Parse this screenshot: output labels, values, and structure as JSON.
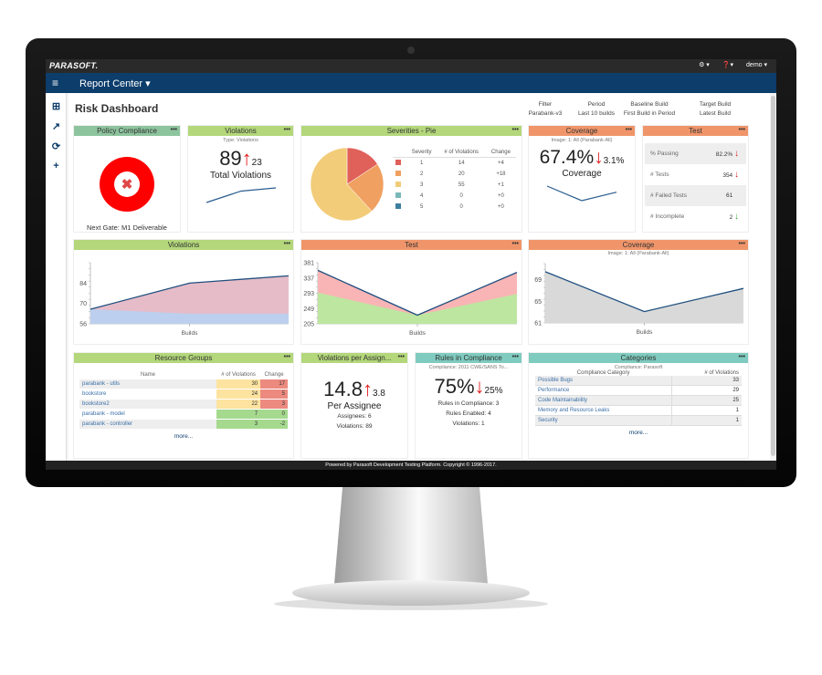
{
  "topbar": {
    "brand": "PARASOFT.",
    "settings_icon": "gear-icon",
    "help_icon": "help-icon",
    "user": "demo ▾",
    "caret": "▾"
  },
  "nav": {
    "menu_icon": "hamburger-icon",
    "title": "Report Center ▾"
  },
  "sidebar": {
    "items": [
      {
        "icon": "add-widget-icon",
        "glyph": "⊞"
      },
      {
        "icon": "share-icon",
        "glyph": "↗"
      },
      {
        "icon": "refresh-icon",
        "glyph": "⟳"
      },
      {
        "icon": "plus-icon",
        "glyph": "+"
      }
    ]
  },
  "dashboard": {
    "title": "Risk Dashboard",
    "filters": [
      {
        "label": "Filter",
        "value": "Parabank-v3"
      },
      {
        "label": "Period",
        "value": "Last 10 builds"
      },
      {
        "label": "Baseline Build",
        "value": "First Build in Period"
      },
      {
        "label": "Target Build",
        "value": "Latest Build"
      }
    ]
  },
  "menu_glyph": "•••",
  "policy": {
    "title": "Policy Compliance",
    "status": "failed",
    "caption": "Next Gate: M1 Deliverable"
  },
  "violations": {
    "title": "Violations",
    "subtitle": "Type: Violations",
    "value": "89",
    "arrow": "↑",
    "delta": "23",
    "caption": "Total Violations",
    "trend": [
      66,
      84,
      89
    ]
  },
  "severities": {
    "title": "Severities - Pie",
    "headers": [
      "Severity",
      "# of Violations",
      "Change"
    ],
    "rows": [
      {
        "severity": "1",
        "count": 14,
        "change": "+4",
        "color": "#e0605a"
      },
      {
        "severity": "2",
        "count": 20,
        "change": "+18",
        "color": "#f0a060"
      },
      {
        "severity": "3",
        "count": 55,
        "change": "+1",
        "color": "#f2cc78"
      },
      {
        "severity": "4",
        "count": 0,
        "change": "+0",
        "color": "#7ab8b8"
      },
      {
        "severity": "5",
        "count": 0,
        "change": "+0",
        "color": "#3d7fa0"
      }
    ]
  },
  "coverage": {
    "title": "Coverage",
    "subtitle": "Image: 1: All (Parabank-All)",
    "value": "67.4%",
    "arrow": "↓",
    "delta": "3.1%",
    "caption": "Coverage",
    "trend": [
      70.5,
      63.1,
      67.4
    ]
  },
  "test": {
    "title": "Test",
    "rows": [
      {
        "label": "% Passing",
        "value": "82.2%",
        "arrow": "↓",
        "dir": "down"
      },
      {
        "label": "# Tests",
        "value": "354",
        "arrow": "↓",
        "dir": "down"
      },
      {
        "label": "# Failed Tests",
        "value": "61",
        "arrow": "",
        "dir": ""
      },
      {
        "label": "# Incomplete",
        "value": "2",
        "arrow": "↓",
        "dir": "good"
      }
    ]
  },
  "chart_data": [
    {
      "type": "area",
      "title": "Violations",
      "xlabel": "Builds",
      "yticks": [
        56,
        70,
        84
      ],
      "ylim": [
        56,
        98
      ],
      "x": [
        1,
        2,
        3
      ],
      "series": [
        {
          "values": [
            66,
            63,
            63
          ],
          "color": "#bccfee"
        },
        {
          "values": [
            66,
            84,
            89
          ],
          "color": "#e6bcc8"
        }
      ]
    },
    {
      "type": "area",
      "title": "Test",
      "xlabel": "Builds",
      "yticks": [
        205,
        249,
        293,
        337,
        381
      ],
      "ylim": [
        205,
        381
      ],
      "x": [
        1,
        2,
        3
      ],
      "series": [
        {
          "values": [
            295,
            230,
            291
          ],
          "color": "#bde6a0"
        },
        {
          "values": [
            359,
            230,
            353
          ],
          "color": "#f9b5b5"
        }
      ]
    },
    {
      "type": "area",
      "title": "Coverage",
      "subtitle": "Image: 1: All (Parabank-All)",
      "xlabel": "Builds",
      "yticks": [
        61,
        65,
        69
      ],
      "ylim": [
        61,
        72
      ],
      "x": [
        1,
        2,
        3
      ],
      "series": [
        {
          "values": [
            70.5,
            63.1,
            67.4
          ],
          "color": "#d9d9d9"
        }
      ]
    }
  ],
  "resource_groups": {
    "title": "Resource Groups",
    "headers": [
      "Name",
      "# of Violations",
      "Change"
    ],
    "rows": [
      {
        "name": "parabank - utils",
        "count": "30",
        "change": "17",
        "level": "high"
      },
      {
        "name": "bookstore",
        "count": "24",
        "change": "5",
        "level": "high"
      },
      {
        "name": "bookstore2",
        "count": "22",
        "change": "3",
        "level": "high"
      },
      {
        "name": "parabank - model",
        "count": "7",
        "change": "0",
        "level": "low"
      },
      {
        "name": "parabank - controller",
        "count": "3",
        "change": "-2",
        "level": "low"
      }
    ],
    "more": "more..."
  },
  "per_assignee": {
    "title": "Violations per Assign...",
    "value": "14.8",
    "arrow": "↑",
    "delta": "3.8",
    "caption": "Per Assignee",
    "lines": [
      "Assignees: 6",
      "Violations: 89"
    ]
  },
  "rules": {
    "title": "Rules in Compliance",
    "subtitle": "Compliance: 2011 CWE/SANS To...",
    "value": "75%",
    "arrow": "↓",
    "delta": "25%",
    "lines": [
      "Rules in Compliance: 3",
      "Rules Enabled: 4",
      "Violations: 1"
    ]
  },
  "categories": {
    "title": "Categories",
    "subtitle": "Compliance: Parasoft",
    "headers": [
      "Compliance Category",
      "# of Violations"
    ],
    "rows": [
      {
        "name": "Possible Bugs",
        "count": "33"
      },
      {
        "name": "Performance",
        "count": "29"
      },
      {
        "name": "Code Maintainability",
        "count": "25"
      },
      {
        "name": "Memory and Resource Leaks",
        "count": "1"
      },
      {
        "name": "Security",
        "count": "1"
      }
    ],
    "more": "more..."
  },
  "footer": "Powered by Parasoft Development Testing Platform. Copyright © 1996-2017."
}
